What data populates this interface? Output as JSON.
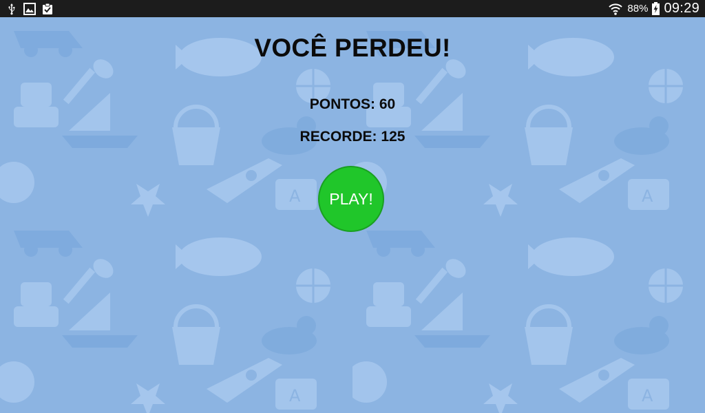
{
  "status_bar": {
    "left_icons": [
      "usb-icon",
      "image-icon",
      "clipboard-check-icon"
    ],
    "wifi_icon": "wifi-icon",
    "battery_percent": "88%",
    "battery_icon": "battery-charging-icon",
    "time": "09:29"
  },
  "game_over": {
    "title": "VOCÊ PERDEU!",
    "score_text": "PONTOS: 60",
    "record_text": "RECORDE: 125",
    "play_label": "PLAY!"
  },
  "colors": {
    "background": "#8cb4e2",
    "pattern_light": "#a8c8ee",
    "pattern_dark": "#7aa5d8",
    "play_button": "#20c62a",
    "status_bar": "#1c1c1c"
  }
}
